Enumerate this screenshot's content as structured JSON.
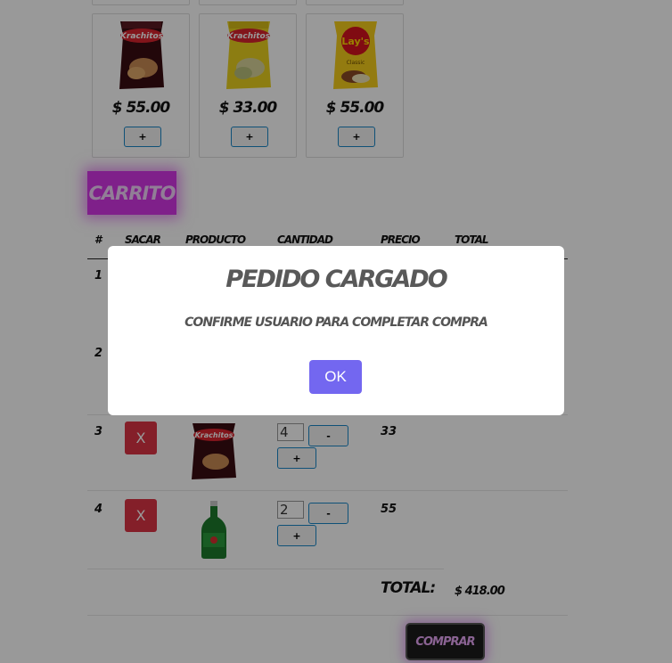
{
  "products": [
    {
      "name": "Krachitos",
      "variant": "",
      "price": "$ 55.00",
      "add_label": "+",
      "bag_color": "#3a0d12",
      "brand_color": "#d9232e"
    },
    {
      "name": "Krachitos",
      "variant": "",
      "price": "$ 33.00",
      "add_label": "+",
      "bag_color": "#ead11f",
      "brand_color": "#d9232e"
    },
    {
      "name": "Lay's",
      "variant": "Classic",
      "price": "$ 55.00",
      "add_label": "+",
      "bag_color": "#f5cd1c",
      "brand_color": "#d6131f"
    }
  ],
  "cart": {
    "title": "CARRITO",
    "headers": [
      "#",
      "SACAR",
      "PRODUCTO",
      "CANTIDAD",
      "PRECIO",
      "TOTAL"
    ],
    "rows": [
      {
        "num": "1"
      },
      {
        "num": "2"
      },
      {
        "num": "3",
        "remove_label": "X",
        "product_icon": "chip-bag-icon",
        "qty": "4",
        "minus_label": "-",
        "plus_label": "+",
        "price": "33"
      },
      {
        "num": "4",
        "remove_label": "X",
        "product_icon": "beer-bottle-icon",
        "qty": "2",
        "minus_label": "-",
        "plus_label": "+",
        "price": "55"
      }
    ],
    "total_label": "TOTAL:",
    "total_value": "$ 418.00",
    "buy_label": "COMPRAR"
  },
  "modal": {
    "title": "PEDIDO CARGADO",
    "message": "CONFIRME USUARIO PARA COMPLETAR COMPRA",
    "ok_label": "OK"
  },
  "colors": {
    "accent_pink": "#d436e6",
    "remove_red": "#dc3545",
    "ok_purple": "#7367f0",
    "button_border": "#1a88c9"
  }
}
